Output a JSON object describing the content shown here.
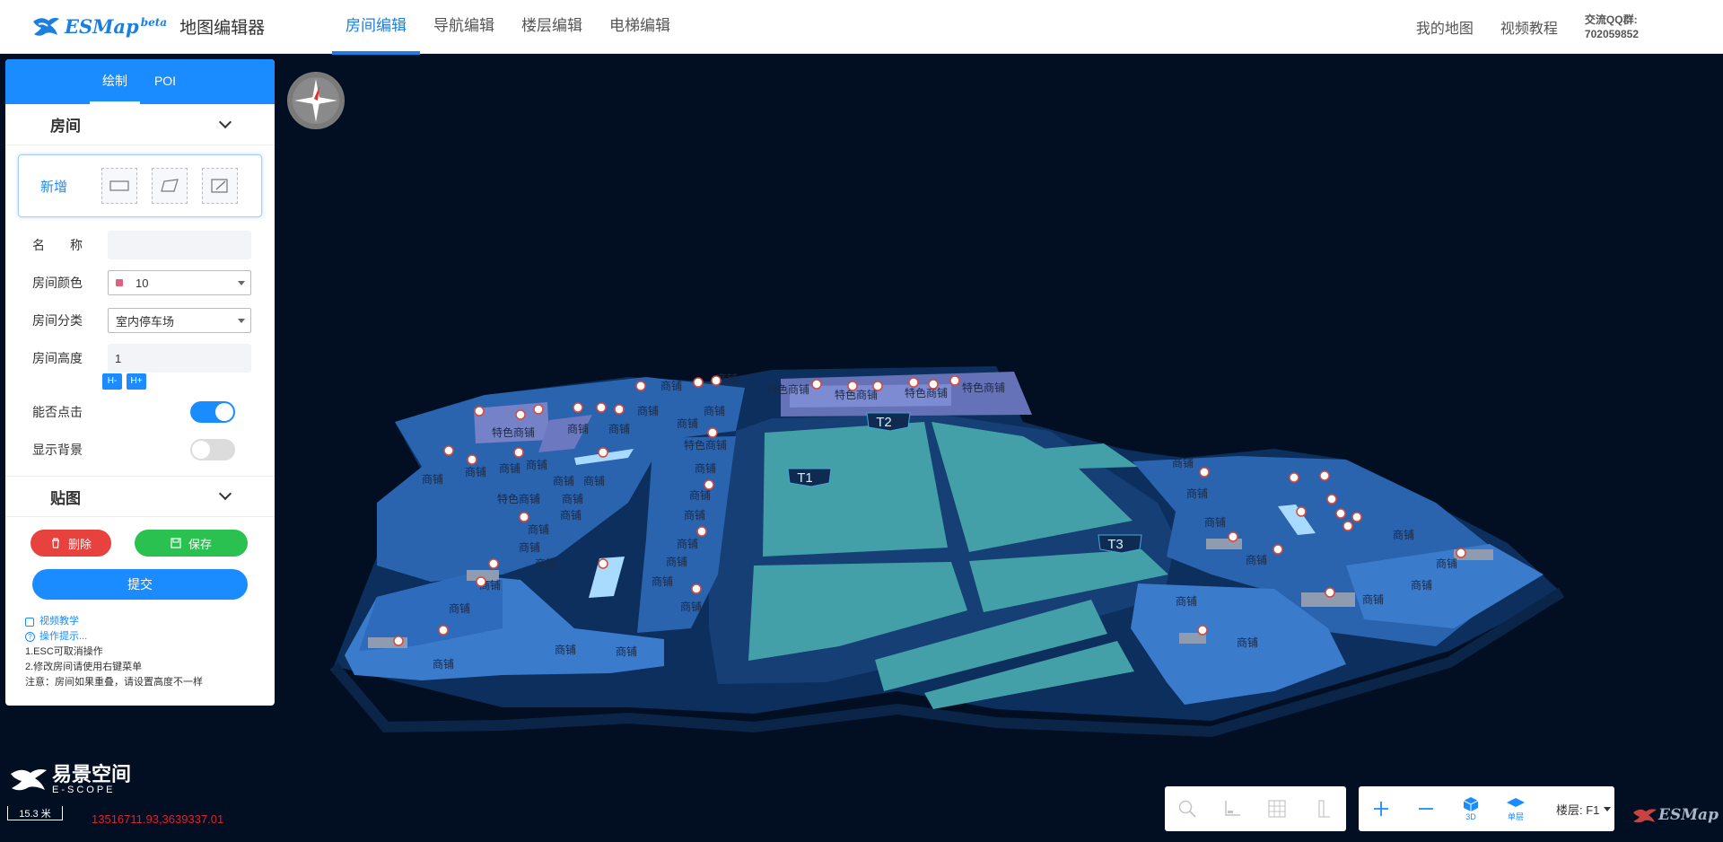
{
  "header": {
    "logo_text": "ESMap",
    "logo_beta": "beta",
    "app_title": "地图编辑器",
    "nav": [
      "房间编辑",
      "导航编辑",
      "楼层编辑",
      "电梯编辑"
    ],
    "my_map": "我的地图",
    "video_tutorial": "视频教程",
    "qq_label": "交流QQ群:",
    "qq_number": "702059852",
    "accent": "#1a7fe0"
  },
  "panel": {
    "tabs": [
      "绘制",
      "POI"
    ],
    "room_section": "房间",
    "add_label": "新增",
    "name_label": "名　　称",
    "name_value": "",
    "color_label": "房间颜色",
    "color_value": "10",
    "color_swatch": "#e0607e",
    "category_label": "房间分类",
    "category_value": "室内停车场",
    "height_label": "房间高度",
    "height_value": "1",
    "h_minus": "H-",
    "h_plus": "H+",
    "clickable_label": "能否点击",
    "clickable_on": true,
    "show_bg_label": "显示背景",
    "show_bg_on": false,
    "texture_section": "贴图",
    "delete_label": "删除",
    "save_label": "保存",
    "submit_label": "提交",
    "help_video": "视频教学",
    "help_tips": "操作提示...",
    "tip1": "1.ESC可取消操作",
    "tip2": "2.修改房间请使用右键菜单",
    "tip3": "注意：房间如果重叠，请设置高度不一样"
  },
  "map": {
    "terminals": [
      "T1",
      "T2",
      "T3"
    ],
    "shop_label": "商铺",
    "special_shop_label": "特色商铺",
    "brand_cn": "易景空间",
    "brand_en": "E-SCOPE",
    "scale": "15.3 米",
    "coords": "13516711.93,3639337.01",
    "floor_label": "楼层: F1",
    "btn_3d": "3D",
    "btn_single": "单层",
    "esmap_wm": "ESMap"
  }
}
